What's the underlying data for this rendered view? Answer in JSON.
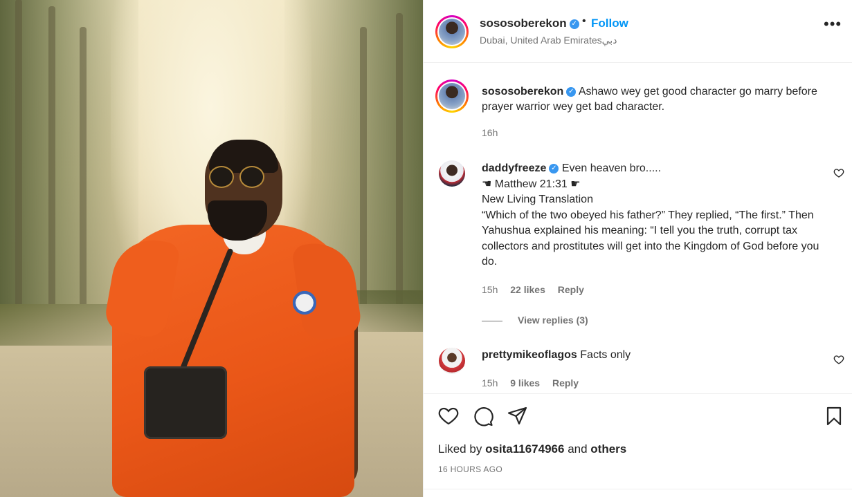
{
  "post": {
    "username": "sososoberekon",
    "follow_label": "Follow",
    "location": "Dubai, United Arab Emiratesدبي",
    "caption_text": "Ashawo wey get good character go marry before prayer warrior wey get bad character.",
    "caption_time": "16h"
  },
  "comments": [
    {
      "username": "daddyfreeze",
      "verified": true,
      "text": "Even heaven bro.....\n☚ Matthew 21:31 ☛\nNew Living Translation\n“Which of the two obeyed his father?” They replied, “The first.” Then Yahushua explained his meaning: “I tell you the truth, corrupt tax collectors and prostitutes will get into the Kingdom of God before you do.",
      "time": "15h",
      "likes": "22 likes",
      "reply_label": "Reply",
      "view_replies": "View replies (3)"
    },
    {
      "username": "prettymikeoflagos",
      "verified": false,
      "text": "Facts only",
      "time": "15h",
      "likes": "9 likes",
      "reply_label": "Reply"
    }
  ],
  "footer": {
    "liked_prefix": "Liked by",
    "liked_user": "osita11674966",
    "liked_and": "and",
    "liked_others": "others",
    "time_ago": "16 HOURS AGO"
  },
  "icons": {
    "more": "more-options-icon",
    "like": "heart-icon",
    "comment": "comment-icon",
    "share": "paper-plane-icon",
    "save": "bookmark-icon",
    "verified": "verified-badge-icon"
  },
  "colors": {
    "accent": "#0095f6",
    "verified": "#3897f0",
    "muted": "#737373",
    "text": "#262626"
  }
}
